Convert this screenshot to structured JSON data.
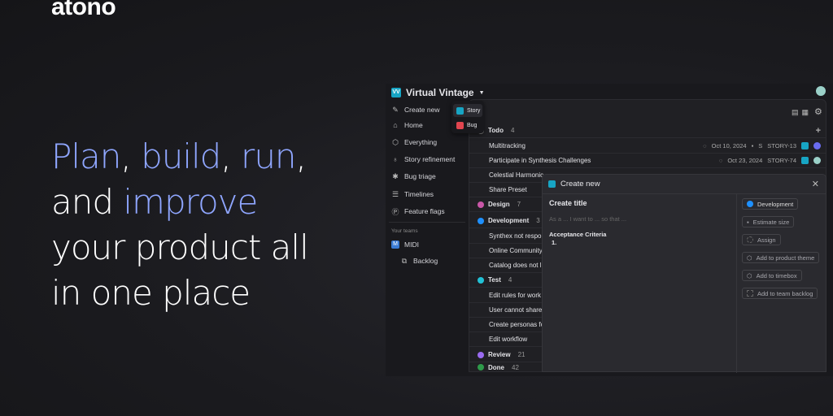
{
  "logo": "atono",
  "hero": {
    "l1a": "Plan",
    "c1": ", ",
    "l1b": "build",
    "c2": ", ",
    "l1c": "run",
    "c3": ",",
    "l2a": "and ",
    "l2b": "improve",
    "l3": "your product all",
    "l4": "in one place"
  },
  "workspace": {
    "badge": "VV",
    "name": "Virtual Vintage"
  },
  "nav": [
    "Create new",
    "Home",
    "Everything",
    "Story refinement",
    "Bug triage",
    "Timelines",
    "Feature flags"
  ],
  "teams": {
    "label": "Your teams",
    "team": "MIDI",
    "team_badge": "M",
    "backlog": "Backlog"
  },
  "create_menu": [
    "Story",
    "Bug"
  ],
  "groups": [
    {
      "name": "Todo",
      "count": "4",
      "color": "#888888"
    },
    {
      "name": "Design",
      "count": "7",
      "color": "#c957a8"
    },
    {
      "name": "Development",
      "count": "3",
      "color": "#1e90ff"
    },
    {
      "name": "Test",
      "count": "4",
      "color": "#22c1d6"
    },
    {
      "name": "Review",
      "count": "21",
      "color": "#9a6bf0"
    },
    {
      "name": "Done",
      "count": "42",
      "color": "#2e9a4a"
    }
  ],
  "todo_items": [
    {
      "title": "Multitracking",
      "date": "Oct 10, 2024",
      "size": "S",
      "id": "STORY-13",
      "avatar": "PG"
    },
    {
      "title": "Participate in Synthesis Challenges",
      "date": "Oct 23, 2024",
      "size": "",
      "id": "STORY-74"
    },
    {
      "title": "Celestial Harmonic"
    },
    {
      "title": "Share Preset"
    }
  ],
  "dev_items": [
    "Synthex not respo",
    "Online Community",
    "Catalog does not l"
  ],
  "test_items": [
    "Edit rules for work",
    "User cannot share",
    "Create personas fo",
    "Edit workflow"
  ],
  "modal": {
    "title": "Create new",
    "create_title": "Create title",
    "placeholder": "As a ... I want to ... so that ...",
    "ac": "Acceptance Criteria",
    "ac_item": "1.",
    "actions": [
      "Development",
      "Estimate size",
      "Assign",
      "Add to product theme",
      "Add to timebox",
      "Add to team backlog"
    ]
  }
}
